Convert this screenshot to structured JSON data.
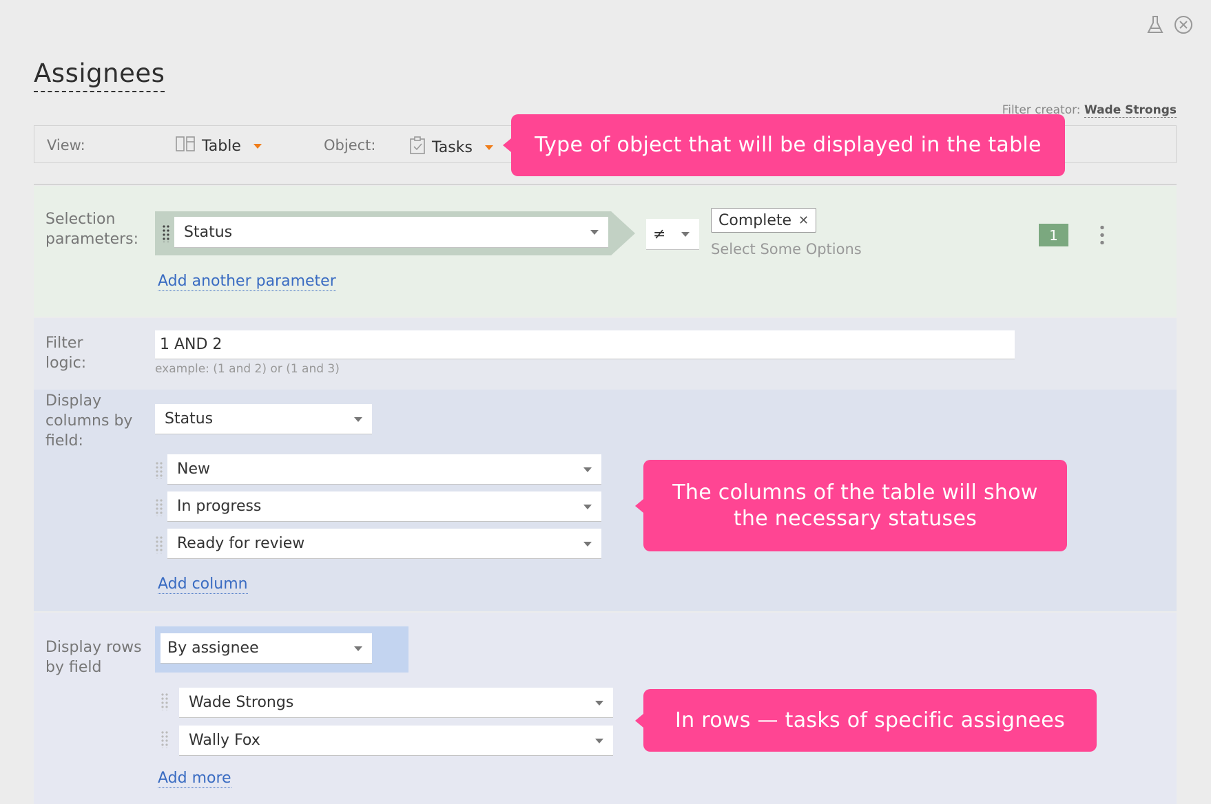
{
  "title": "Assignees",
  "filter_creator": {
    "label": "Filter creator:",
    "name": "Wade Strongs"
  },
  "viewbar": {
    "view_label": "View:",
    "view_value": "Table",
    "object_label": "Object:",
    "object_value": "Tasks"
  },
  "callouts": {
    "object": "Type of object that will be displayed in the table",
    "columns": "The columns of the table will show the necessary statuses",
    "rows": "In rows — tasks of specific assignees"
  },
  "selection": {
    "label": "Selection parameters:",
    "field": "Status",
    "operator": "≠",
    "tag": "Complete",
    "placeholder": "Select Some Options",
    "badge": "1",
    "add_link": "Add another parameter"
  },
  "logic": {
    "label": "Filter logic:",
    "value": "1 AND 2",
    "hint": "example: (1 and 2) or (1 and 3)"
  },
  "columns": {
    "label": "Display columns by field:",
    "field": "Status",
    "items": [
      "New",
      "In progress",
      "Ready for review"
    ],
    "add_link": "Add column"
  },
  "rows": {
    "label": "Display rows by field",
    "field": "By assignee",
    "items": [
      "Wade Strongs",
      "Wally Fox"
    ],
    "add_link": "Add more"
  },
  "colors": {
    "callout": "#ff4593",
    "accent_orange": "#f07d1a",
    "link": "#3a6cc2",
    "badge": "#7ba87f"
  }
}
